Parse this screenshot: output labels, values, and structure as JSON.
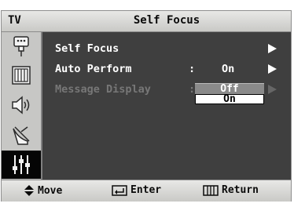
{
  "header": {
    "tab_label": "TV",
    "title": "Self Focus"
  },
  "sidebar": {
    "items": [
      {
        "icon": "input-icon"
      },
      {
        "icon": "picture-icon"
      },
      {
        "icon": "sound-icon"
      },
      {
        "icon": "channel-icon"
      },
      {
        "icon": "setup-icon",
        "active": true
      }
    ]
  },
  "menu": {
    "items": [
      {
        "label": "Self Focus",
        "value": ""
      },
      {
        "label": "Auto Perform",
        "value": "On"
      },
      {
        "label": "Message Display",
        "value": ""
      }
    ],
    "separator": ":"
  },
  "dropdown": {
    "options": [
      "Off",
      "On"
    ],
    "highlighted": "Off"
  },
  "footer": {
    "move_label": "Move",
    "enter_label": "Enter",
    "return_label": "Return"
  },
  "colors": {
    "menu_bg": "#3f3f3f",
    "bar_bg": "#d4d4d2",
    "sidebar_bg": "#c7c7c5",
    "active_bg": "#050505",
    "highlight": "#8a8a8a"
  }
}
